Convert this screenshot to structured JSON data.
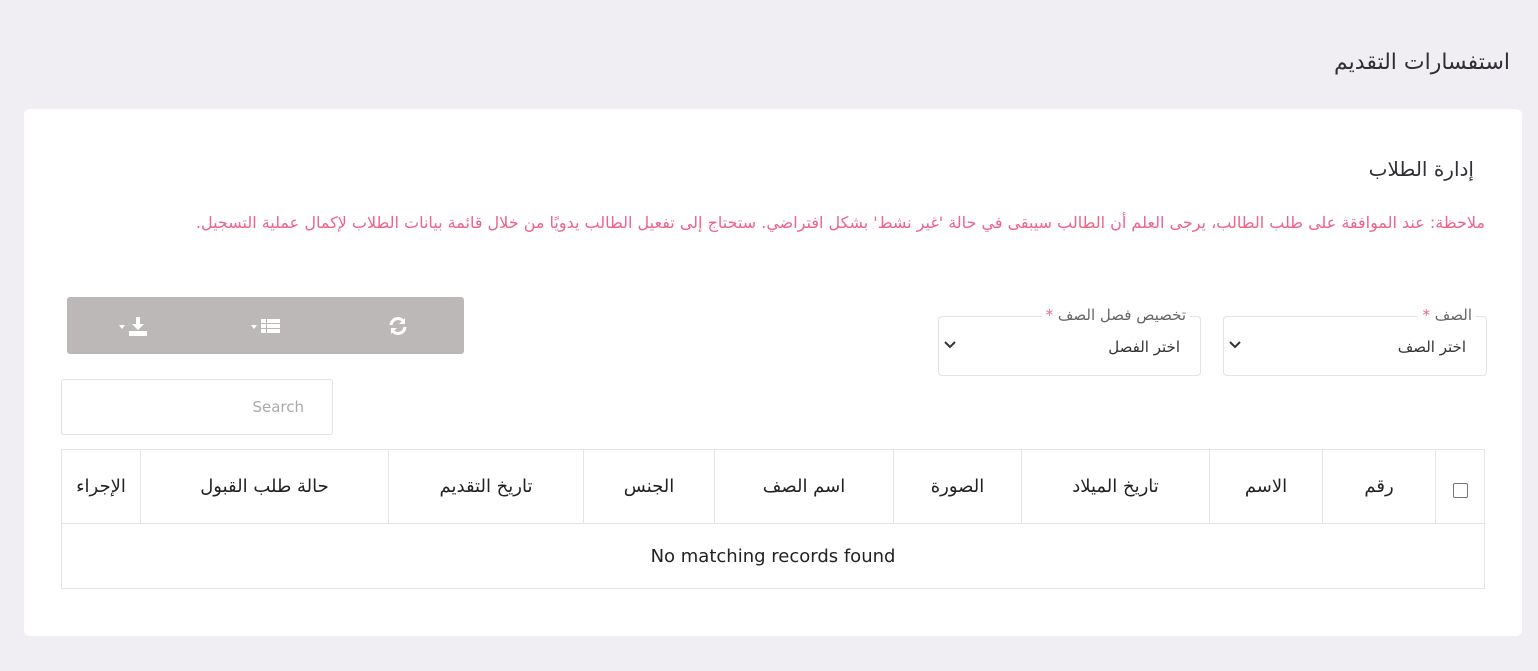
{
  "page": {
    "title": "استفسارات التقديم"
  },
  "card": {
    "title": "إدارة الطلاب",
    "note": "ملاحظة: عند الموافقة على طلب الطالب، يرجى العلم أن الطالب سيبقى في حالة 'غير نشط' بشكل افتراضي. ستحتاج إلى تفعيل الطالب يدويًا من خلال قائمة بيانات الطلاب لإكمال عملية التسجيل."
  },
  "filters": {
    "class": {
      "label": "الصف",
      "required_mark": "*",
      "value": "اختر الصف"
    },
    "section": {
      "label": "تخصيص فصل الصف",
      "required_mark": "*",
      "value": "اختر الفصل"
    }
  },
  "toolbar": {
    "refresh_icon": "refresh-icon",
    "columns_icon": "list-icon",
    "export_icon": "download-icon",
    "color": "#bdb8b8"
  },
  "search": {
    "placeholder": "Search"
  },
  "table": {
    "headers": [
      "رقم",
      "الاسم",
      "تاريخ الميلاد",
      "الصورة",
      "اسم الصف",
      "الجنس",
      "تاريخ التقديم",
      "حالة طلب القبول",
      "الإجراء"
    ],
    "empty_message": "No matching records found"
  },
  "colors": {
    "note": "#f0628a",
    "background": "#f1eef3"
  }
}
